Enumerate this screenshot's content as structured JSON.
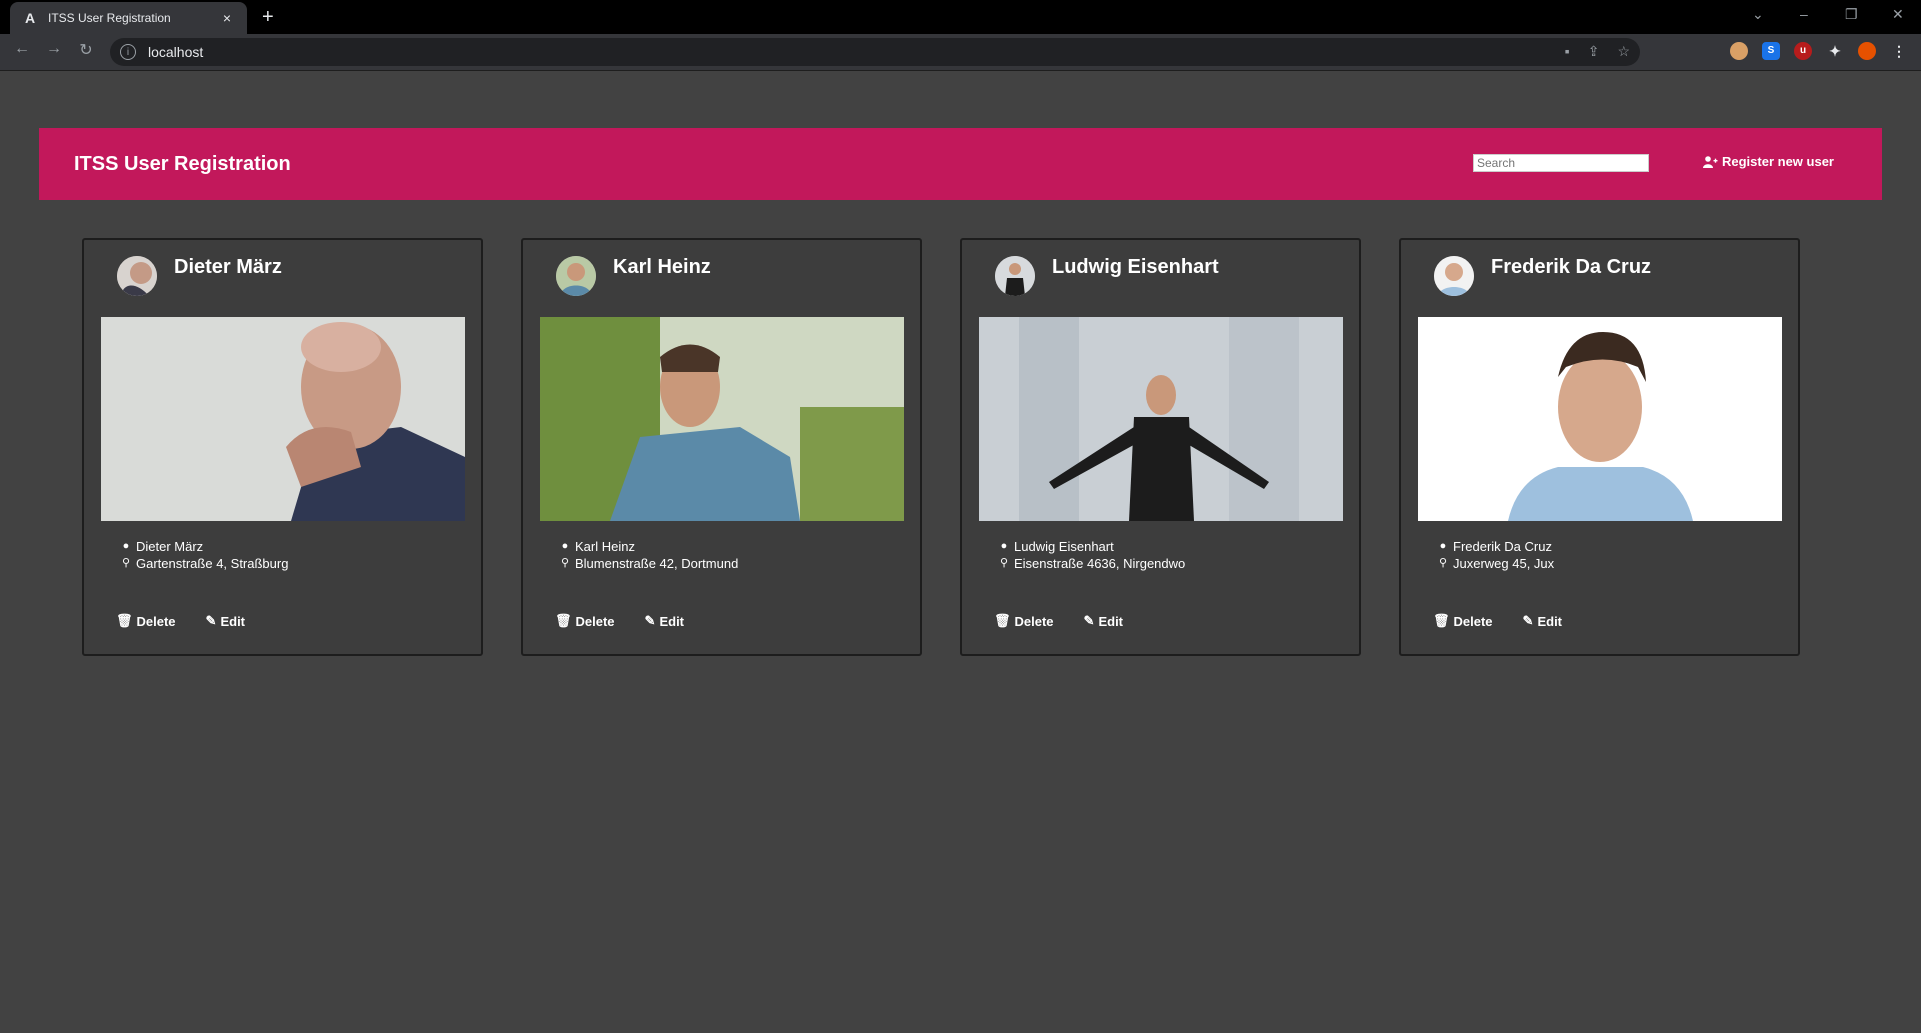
{
  "browser": {
    "tab_title": "ITSS User Registration",
    "tab_favicon": "A",
    "new_tab": "+",
    "close": "×",
    "url": "localhost",
    "window_controls": [
      "⌄",
      "–",
      "❐",
      "✕"
    ]
  },
  "app": {
    "title": "ITSS User Registration",
    "search_placeholder": "Search",
    "register_label": "Register new user"
  },
  "users": [
    {
      "name": "Dieter März",
      "address": "Gartenstraße 4, Straßburg",
      "delete": "Delete",
      "edit": "Edit"
    },
    {
      "name": "Karl Heinz",
      "address": "Blumenstraße 42, Dortmund",
      "delete": "Delete",
      "edit": "Edit"
    },
    {
      "name": "Ludwig Eisenhart",
      "address": "Eisenstraße 4636, Nirgendwo",
      "delete": "Delete",
      "edit": "Edit"
    },
    {
      "name": "Frederik Da Cruz",
      "address": "Juxerweg 45, Jux",
      "delete": "Delete",
      "edit": "Edit"
    }
  ],
  "colors": {
    "appbar": "#c2185b",
    "page_bg": "#424242"
  }
}
